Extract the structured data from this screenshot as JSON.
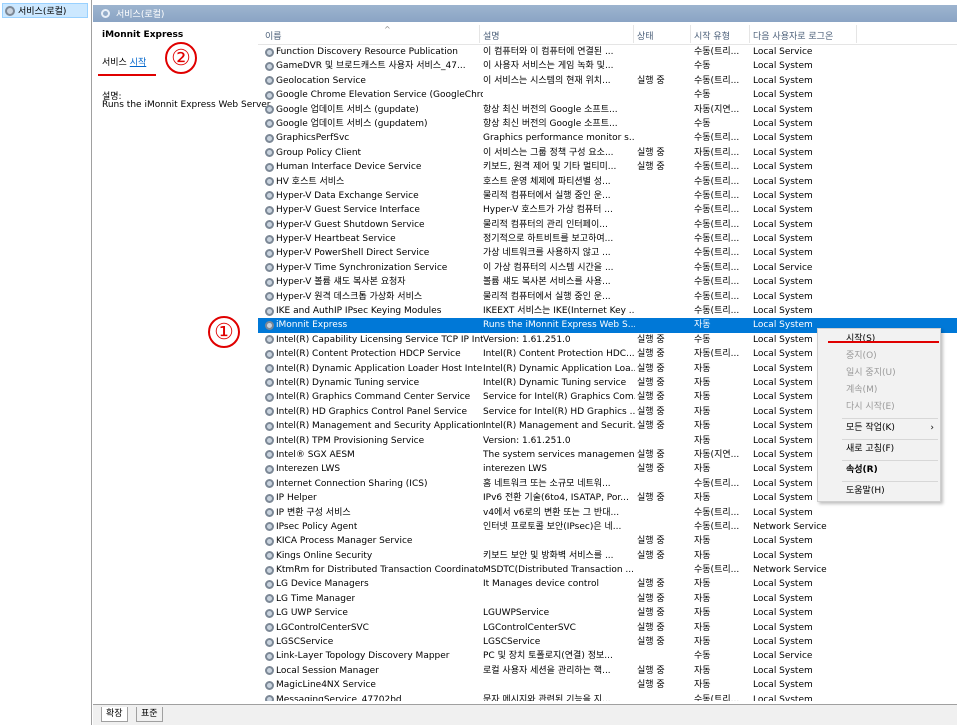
{
  "tree": {
    "root_label": "서비스(로컬)"
  },
  "header": {
    "title": "서비스(로컬)"
  },
  "description_pane": {
    "service_name": "iMonnit Express",
    "action_prefix": "서비스",
    "action_link": "시작",
    "desc_label": "설명:",
    "desc_text": "Runs the iMonnit Express Web Server"
  },
  "annotations": {
    "marker_1": "①",
    "marker_2": "②",
    "accent_color": "#e00000"
  },
  "columns": {
    "name": "이름",
    "description": "설명",
    "status": "상태",
    "startup_type": "시작 유형",
    "logon_as": "다음 사용자로 로그온"
  },
  "services": [
    {
      "name": "Function Discovery Resource Publication",
      "desc": "이 컴퓨터와 이 컴퓨터에 연결된 ...",
      "status": "",
      "start": "수동(트리...",
      "logon": "Local Service"
    },
    {
      "name": "GameDVR 및 브로드캐스트 사용자 서비스_47...",
      "desc": "이 사용자 서비스는 게임 녹화 및...",
      "status": "",
      "start": "수동",
      "logon": "Local System"
    },
    {
      "name": "Geolocation Service",
      "desc": "이 서비스는 시스템의 현재 위치...",
      "status": "실행 중",
      "start": "수동(트리...",
      "logon": "Local System"
    },
    {
      "name": "Google Chrome Elevation Service (GoogleChro...",
      "desc": "",
      "status": "",
      "start": "수동",
      "logon": "Local System"
    },
    {
      "name": "Google 업데이트 서비스 (gupdate)",
      "desc": "항상 최신 버전의 Google 소프트...",
      "status": "",
      "start": "자동(지연...",
      "logon": "Local System"
    },
    {
      "name": "Google 업데이트 서비스 (gupdatem)",
      "desc": "항상 최신 버전의 Google 소프트...",
      "status": "",
      "start": "수동",
      "logon": "Local System"
    },
    {
      "name": "GraphicsPerfSvc",
      "desc": "Graphics performance monitor s...",
      "status": "",
      "start": "수동(트리...",
      "logon": "Local System"
    },
    {
      "name": "Group Policy Client",
      "desc": "이 서비스는 그룹 정책 구성 요소...",
      "status": "실행 중",
      "start": "자동(트리...",
      "logon": "Local System"
    },
    {
      "name": "Human Interface Device Service",
      "desc": "키보드, 원격 제어 및 기타 멀티미...",
      "status": "실행 중",
      "start": "수동(트리...",
      "logon": "Local System"
    },
    {
      "name": "HV 호스트 서비스",
      "desc": "호스트 운영 체제에 파티션별 성...",
      "status": "",
      "start": "수동(트리...",
      "logon": "Local System"
    },
    {
      "name": "Hyper-V Data Exchange Service",
      "desc": "물리적 컴퓨터에서 실행 중인 운...",
      "status": "",
      "start": "수동(트리...",
      "logon": "Local System"
    },
    {
      "name": "Hyper-V Guest Service Interface",
      "desc": "Hyper-V 호스트가 가상 컴퓨터 ...",
      "status": "",
      "start": "수동(트리...",
      "logon": "Local System"
    },
    {
      "name": "Hyper-V Guest Shutdown Service",
      "desc": "물리적 컴퓨터의 관리 인터페이...",
      "status": "",
      "start": "수동(트리...",
      "logon": "Local System"
    },
    {
      "name": "Hyper-V Heartbeat Service",
      "desc": "정기적으로 하트비트를 보고하여...",
      "status": "",
      "start": "수동(트리...",
      "logon": "Local System"
    },
    {
      "name": "Hyper-V PowerShell Direct Service",
      "desc": "가상 네트워크를 사용하지 않고 ...",
      "status": "",
      "start": "수동(트리...",
      "logon": "Local System"
    },
    {
      "name": "Hyper-V Time Synchronization Service",
      "desc": "이 가상 컴퓨터의 시스템 시간을 ...",
      "status": "",
      "start": "수동(트리...",
      "logon": "Local Service"
    },
    {
      "name": "Hyper-V 볼륨 섀도 복사본 요청자",
      "desc": "볼륨 섀도 복사본 서비스를 사용...",
      "status": "",
      "start": "수동(트리...",
      "logon": "Local System"
    },
    {
      "name": "Hyper-V 원격 데스크톱 가상화 서비스",
      "desc": "물리적 컴퓨터에서 실행 중인 운...",
      "status": "",
      "start": "수동(트리...",
      "logon": "Local System"
    },
    {
      "name": "IKE and AuthIP IPsec Keying Modules",
      "desc": "IKEEXT 서비스는 IKE(Internet Key ...",
      "status": "",
      "start": "수동(트리...",
      "logon": "Local System"
    },
    {
      "name": "iMonnit Express",
      "desc": "Runs the iMonnit Express Web S...",
      "status": "",
      "start": "자동",
      "logon": "Local System",
      "selected": true
    },
    {
      "name": "Intel(R) Capability Licensing Service TCP IP Int...",
      "desc": "Version: 1.61.251.0",
      "status": "실행 중",
      "start": "수동",
      "logon": "Local System"
    },
    {
      "name": "Intel(R) Content Protection HDCP Service",
      "desc": "Intel(R) Content Protection HDC...",
      "status": "실행 중",
      "start": "자동(트리...",
      "logon": "Local System"
    },
    {
      "name": "Intel(R) Dynamic Application Loader Host Inter...",
      "desc": "Intel(R) Dynamic Application Loa...",
      "status": "실행 중",
      "start": "자동",
      "logon": "Local System"
    },
    {
      "name": "Intel(R) Dynamic Tuning service",
      "desc": "Intel(R) Dynamic Tuning service",
      "status": "실행 중",
      "start": "자동",
      "logon": "Local System"
    },
    {
      "name": "Intel(R) Graphics Command Center Service",
      "desc": "Service for Intel(R) Graphics Com...",
      "status": "실행 중",
      "start": "자동",
      "logon": "Local System"
    },
    {
      "name": "Intel(R) HD Graphics Control Panel Service",
      "desc": "Service for Intel(R) HD Graphics ...",
      "status": "실행 중",
      "start": "자동",
      "logon": "Local System"
    },
    {
      "name": "Intel(R) Management and Security Application...",
      "desc": "Intel(R) Management and Securit...",
      "status": "실행 중",
      "start": "자동",
      "logon": "Local System"
    },
    {
      "name": "Intel(R) TPM Provisioning Service",
      "desc": "Version: 1.61.251.0",
      "status": "",
      "start": "자동",
      "logon": "Local System"
    },
    {
      "name": "Intel® SGX AESM",
      "desc": "The system services managemen...",
      "status": "실행 중",
      "start": "자동(지연...",
      "logon": "Local System"
    },
    {
      "name": "Interezen LWS",
      "desc": "interezen LWS",
      "status": "실행 중",
      "start": "자동",
      "logon": "Local System"
    },
    {
      "name": "Internet Connection Sharing (ICS)",
      "desc": "홈 네트워크 또는 소규모 네트워...",
      "status": "",
      "start": "수동(트리...",
      "logon": "Local System"
    },
    {
      "name": "IP Helper",
      "desc": "IPv6 전환 기술(6to4, ISATAP, Por...",
      "status": "실행 중",
      "start": "자동",
      "logon": "Local System"
    },
    {
      "name": "IP 변환 구성 서비스",
      "desc": "v4에서 v6로의 변환 또는 그 반대...",
      "status": "",
      "start": "수동(트리...",
      "logon": "Local System"
    },
    {
      "name": "IPsec Policy Agent",
      "desc": "인터넷 프로토콜 보안(IPsec)은 네...",
      "status": "",
      "start": "수동(트리...",
      "logon": "Network Service"
    },
    {
      "name": "KICA Process Manager Service",
      "desc": "",
      "status": "실행 중",
      "start": "자동",
      "logon": "Local System"
    },
    {
      "name": "Kings Online Security",
      "desc": "키보드 보안 및 방화벽 서비스를 ...",
      "status": "실행 중",
      "start": "자동",
      "logon": "Local System"
    },
    {
      "name": "KtmRm for Distributed Transaction Coordinator",
      "desc": "MSDTC(Distributed Transaction ...",
      "status": "",
      "start": "수동(트리...",
      "logon": "Network Service"
    },
    {
      "name": "LG Device Managers",
      "desc": "It Manages device control",
      "status": "실행 중",
      "start": "자동",
      "logon": "Local System"
    },
    {
      "name": "LG Time Manager",
      "desc": "",
      "status": "실행 중",
      "start": "자동",
      "logon": "Local System"
    },
    {
      "name": "LG UWP Service",
      "desc": "LGUWPService",
      "status": "실행 중",
      "start": "자동",
      "logon": "Local System"
    },
    {
      "name": "LGControlCenterSVC",
      "desc": "LGControlCenterSVC",
      "status": "실행 중",
      "start": "자동",
      "logon": "Local System"
    },
    {
      "name": "LGSCService",
      "desc": "LGSCService",
      "status": "실행 중",
      "start": "자동",
      "logon": "Local System"
    },
    {
      "name": "Link-Layer Topology Discovery Mapper",
      "desc": "PC 및 장치 토폴로지(연결) 정보...",
      "status": "",
      "start": "수동",
      "logon": "Local Service"
    },
    {
      "name": "Local Session Manager",
      "desc": "로컬 사용자 세션을 관리하는 핵...",
      "status": "실행 중",
      "start": "자동",
      "logon": "Local System"
    },
    {
      "name": "MagicLine4NX Service",
      "desc": "",
      "status": "실행 중",
      "start": "자동",
      "logon": "Local System"
    },
    {
      "name": "MessagingService_47702bd",
      "desc": "문자 메시지와 관련된 기능을 지...",
      "status": "",
      "start": "수동(트리...",
      "logon": "Local System"
    }
  ],
  "context_menu": {
    "start": "시작(S)",
    "stop": "중지(O)",
    "pause": "일시 중지(U)",
    "resume": "계속(M)",
    "restart": "다시 시작(E)",
    "all_tasks": "모든 작업(K)",
    "all_tasks_arrow": "›",
    "refresh": "새로 고침(F)",
    "properties": "속성(R)",
    "help": "도움말(H)"
  },
  "tabs": {
    "extended": "확장",
    "standard": "표준"
  },
  "colors": {
    "selection": "#0078d7",
    "header_bar": "#8fa9c9",
    "link": "#0066cc"
  }
}
